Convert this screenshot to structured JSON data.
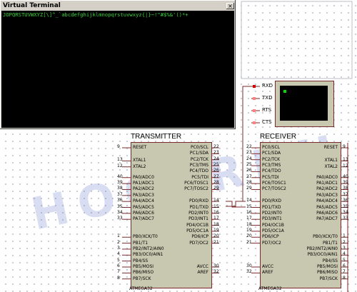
{
  "window": {
    "title": "Virtual Terminal",
    "close_glyph": "×",
    "output": "JOPQRSTUVWXYZ[\\]^_`abcdefghijklmnopqrstuvwxyz{|}~!\"#$%&'()*+"
  },
  "watermark": "HOCARDU",
  "transmitter": {
    "title": "TRANSMITTER",
    "part": "ATMEGA32",
    "left_pins": [
      {
        "num": "9",
        "name": "RESET"
      },
      {
        "num": "13",
        "name": "XTAL1"
      },
      {
        "num": "12",
        "name": "XTAL2"
      },
      {
        "num": "40",
        "name": "PA0/ADC0"
      },
      {
        "num": "39",
        "name": "PA1/ADC1"
      },
      {
        "num": "38",
        "name": "PA2/ADC2"
      },
      {
        "num": "37",
        "name": "PA3/ADC3"
      },
      {
        "num": "36",
        "name": "PA4/ADC4"
      },
      {
        "num": "35",
        "name": "PA5/ADC5"
      },
      {
        "num": "34",
        "name": "PA6/ADC6"
      },
      {
        "num": "33",
        "name": "PA7/ADC7"
      },
      {
        "num": "1",
        "name": "PB0/XCK/T0"
      },
      {
        "num": "2",
        "name": "PB1/T1"
      },
      {
        "num": "3",
        "name": "PB2/INT2/AIN0"
      },
      {
        "num": "4",
        "name": "PB3/OC0/AIN1"
      },
      {
        "num": "5",
        "name": "PB4/SS"
      },
      {
        "num": "6",
        "name": "PB5/MOSI"
      },
      {
        "num": "7",
        "name": "PB6/MISO"
      },
      {
        "num": "8",
        "name": "PB7/SCK"
      }
    ],
    "right_pins": [
      {
        "num": "22",
        "name": "PC0/SCL"
      },
      {
        "num": "23",
        "name": "PC1/SDA"
      },
      {
        "num": "24",
        "name": "PC2/TCK"
      },
      {
        "num": "25",
        "name": "PC3/TMS"
      },
      {
        "num": "26",
        "name": "PC4/TDO"
      },
      {
        "num": "27",
        "name": "PC5/TDI"
      },
      {
        "num": "28",
        "name": "PC6/TOSC1"
      },
      {
        "num": "29",
        "name": "PC7/TOSC2"
      },
      {
        "num": "14",
        "name": "PD0/RXD"
      },
      {
        "num": "15",
        "name": "PD1/TXD"
      },
      {
        "num": "16",
        "name": "PD2/INT0"
      },
      {
        "num": "17",
        "name": "PD3/INT1"
      },
      {
        "num": "18",
        "name": "PD4/OC1B"
      },
      {
        "num": "19",
        "name": "PD5/OC1A"
      },
      {
        "num": "20",
        "name": "PD6/ICP"
      },
      {
        "num": "21",
        "name": "PD7/OC2"
      },
      {
        "num": "30",
        "name": "AVCC"
      },
      {
        "num": "32",
        "name": "AREF"
      }
    ]
  },
  "receiver": {
    "title": "RECEIVER",
    "part": "ATMEGA32",
    "left_pins": [
      {
        "num": "22",
        "name": "PC0/SCL"
      },
      {
        "num": "23",
        "name": "PC1/SDA"
      },
      {
        "num": "24",
        "name": "PC2/TCK"
      },
      {
        "num": "25",
        "name": "PC3/TMS"
      },
      {
        "num": "26",
        "name": "PC4/TDO"
      },
      {
        "num": "27",
        "name": "PC5/TDI"
      },
      {
        "num": "28",
        "name": "PC6/TOSC1"
      },
      {
        "num": "29",
        "name": "PC7/TOSC2"
      },
      {
        "num": "14",
        "name": "PD0/RXD"
      },
      {
        "num": "15",
        "name": "PD1/TXD"
      },
      {
        "num": "16",
        "name": "PD2/INT0"
      },
      {
        "num": "17",
        "name": "PD3/INT1"
      },
      {
        "num": "18",
        "name": "PD4/OC1B"
      },
      {
        "num": "19",
        "name": "PD5/OC1A"
      },
      {
        "num": "20",
        "name": "PD6/ICP"
      },
      {
        "num": "21",
        "name": "PD7/OC2"
      },
      {
        "num": "30",
        "name": "AVCC"
      },
      {
        "num": "32",
        "name": "AREF"
      }
    ],
    "right_pins": [
      {
        "num": "9",
        "name": "RESET"
      },
      {
        "num": "13",
        "name": "XTAL1"
      },
      {
        "num": "12",
        "name": "XTAL2"
      },
      {
        "num": "40",
        "name": "PA0/ADC0"
      },
      {
        "num": "39",
        "name": "PA1/ADC1"
      },
      {
        "num": "38",
        "name": "PA2/ADC2"
      },
      {
        "num": "37",
        "name": "PA3/ADC3"
      },
      {
        "num": "36",
        "name": "PA4/ADC4"
      },
      {
        "num": "35",
        "name": "PA5/ADC5"
      },
      {
        "num": "34",
        "name": "PA6/ADC6"
      },
      {
        "num": "33",
        "name": "PA7/ADC7"
      },
      {
        "num": "1",
        "name": "PB0/XCK/T0"
      },
      {
        "num": "2",
        "name": "PB1/T1"
      },
      {
        "num": "3",
        "name": "PB2/INT2/AIN0"
      },
      {
        "num": "4",
        "name": "PB3/OC0/AIN1"
      },
      {
        "num": "5",
        "name": "PB4/SS"
      },
      {
        "num": "6",
        "name": "PB5/MOSI"
      },
      {
        "num": "7",
        "name": "PB6/MISO"
      },
      {
        "num": "8",
        "name": "PB7/SCK"
      }
    ]
  },
  "terminal_device": {
    "pins": [
      "RXD",
      "TXD",
      "RTS",
      "CTS"
    ]
  }
}
